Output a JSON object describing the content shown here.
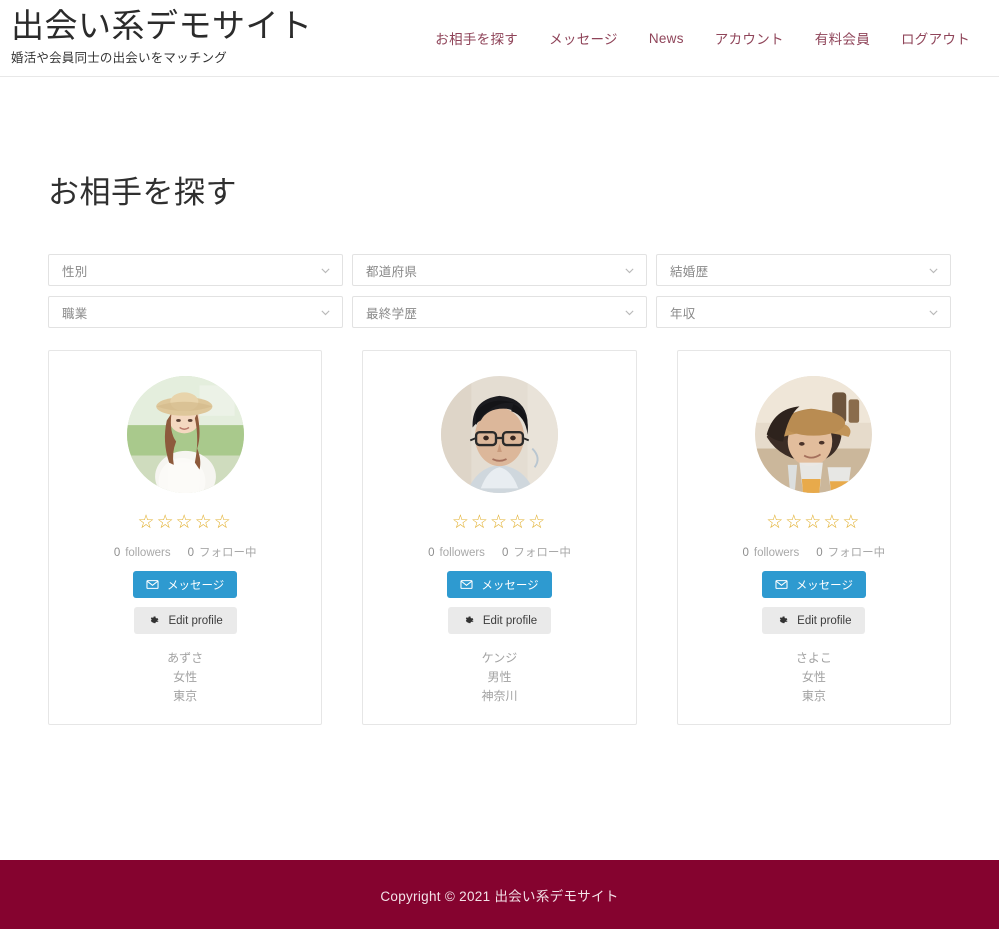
{
  "header": {
    "brand_title": "出会い系デモサイト",
    "brand_subtitle": "婚活や会員同士の出会いをマッチング",
    "nav": [
      {
        "label": "お相手を探す",
        "name": "nav-link-search"
      },
      {
        "label": "メッセージ",
        "name": "nav-link-messages"
      },
      {
        "label": "News",
        "name": "nav-link-news"
      },
      {
        "label": "アカウント",
        "name": "nav-link-account"
      },
      {
        "label": "有料会員",
        "name": "nav-link-premium"
      },
      {
        "label": "ログアウト",
        "name": "nav-link-logout"
      }
    ],
    "nav_color": "#8f4459"
  },
  "main": {
    "page_title": "お相手を探す",
    "filters": [
      {
        "label": "性別",
        "name": "filter-gender"
      },
      {
        "label": "都道府県",
        "name": "filter-prefecture"
      },
      {
        "label": "結婚歴",
        "name": "filter-marital-history"
      },
      {
        "label": "職業",
        "name": "filter-occupation"
      },
      {
        "label": "最終学歴",
        "name": "filter-education"
      },
      {
        "label": "年収",
        "name": "filter-income"
      }
    ],
    "filter_icon": "chevron-down-icon",
    "cards": [
      {
        "avatar": "woman-straw-hat-avatar",
        "rating": 0,
        "stars_total": 5,
        "followers_count": "0",
        "followers_label": "followers",
        "following_count": "0",
        "following_label": "フォロー中",
        "message_button": "メッセージ",
        "message_icon": "envelope-icon",
        "edit_button": "Edit profile",
        "edit_icon": "gear-icon",
        "name": "あずさ",
        "gender": "女性",
        "location": "東京"
      },
      {
        "avatar": "man-glasses-avatar",
        "rating": 0,
        "stars_total": 5,
        "followers_count": "0",
        "followers_label": "followers",
        "following_count": "0",
        "following_label": "フォロー中",
        "message_button": "メッセージ",
        "message_icon": "envelope-icon",
        "edit_button": "Edit profile",
        "edit_icon": "gear-icon",
        "name": "ケンジ",
        "gender": "男性",
        "location": "神奈川"
      },
      {
        "avatar": "woman-cap-drink-avatar",
        "rating": 0,
        "stars_total": 5,
        "followers_count": "0",
        "followers_label": "followers",
        "following_count": "0",
        "following_label": "フォロー中",
        "message_button": "メッセージ",
        "message_icon": "envelope-icon",
        "edit_button": "Edit profile",
        "edit_icon": "gear-icon",
        "name": "さよこ",
        "gender": "女性",
        "location": "東京"
      }
    ],
    "star_glyph": "☆",
    "star_color": "#e2b02f",
    "message_button_color": "#2e9ad0"
  },
  "footer": {
    "copyright": "Copyright © 2021 出会い系デモサイト",
    "background_color": "#85032f"
  }
}
